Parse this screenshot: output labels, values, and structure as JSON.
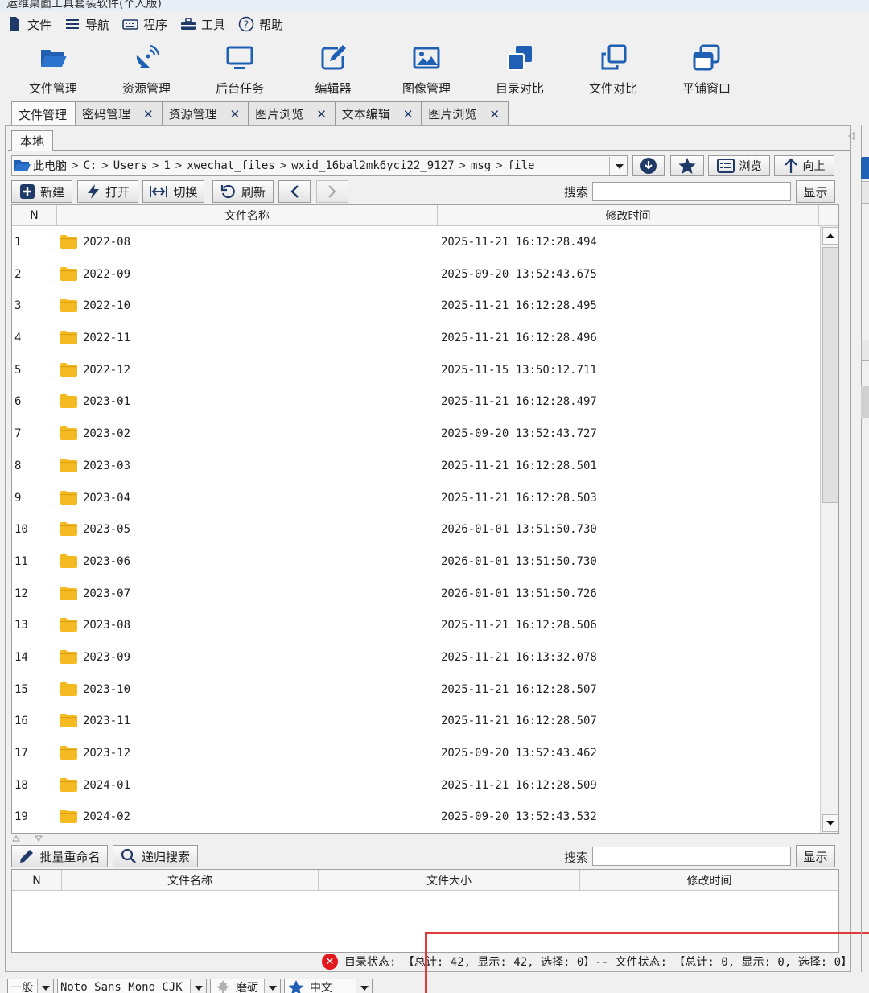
{
  "window": {
    "title": "运维桌面工具套装软件(个人版)"
  },
  "menu": [
    {
      "label": "文件",
      "icon": "file-icon"
    },
    {
      "label": "导航",
      "icon": "hamburger-icon"
    },
    {
      "label": "程序",
      "icon": "keyboard-icon"
    },
    {
      "label": "工具",
      "icon": "toolbox-icon"
    },
    {
      "label": "帮助",
      "icon": "help-icon"
    }
  ],
  "toolbar": [
    {
      "label": "文件管理",
      "icon": "folder-open-icon"
    },
    {
      "label": "资源管理",
      "icon": "satellite-dish-icon"
    },
    {
      "label": "后台任务",
      "icon": "monitor-icon"
    },
    {
      "label": "编辑器",
      "icon": "edit-icon"
    },
    {
      "label": "图像管理",
      "icon": "image-icon"
    },
    {
      "label": "目录对比",
      "icon": "stacked-squares-icon"
    },
    {
      "label": "文件对比",
      "icon": "copy-icon"
    },
    {
      "label": "平铺窗口",
      "icon": "windows-icon"
    }
  ],
  "tabs": [
    {
      "label": "文件管理",
      "closable": false,
      "active": true
    },
    {
      "label": "密码管理",
      "closable": true
    },
    {
      "label": "资源管理",
      "closable": true
    },
    {
      "label": "图片浏览",
      "closable": true
    },
    {
      "label": "文本编辑",
      "closable": true
    },
    {
      "label": "图片浏览",
      "closable": true
    }
  ],
  "tab_close_glyph": "✕",
  "subtab": {
    "label": "本地"
  },
  "path": {
    "segments": [
      "此电脑",
      "C:",
      "Users",
      "1",
      "xwechat_files",
      "wxid_16bal2mk6yci22_9127",
      "msg",
      "file"
    ],
    "separator": ">",
    "browse_label": "浏览",
    "up_label": "向上"
  },
  "actions": {
    "new": "新建",
    "open": "打开",
    "switch": "切换",
    "refresh": "刷新",
    "search_label": "搜索",
    "search_value": "",
    "show": "显示"
  },
  "table": {
    "columns": [
      "N",
      "文件名称",
      "修改时间"
    ],
    "rows": [
      {
        "n": "1",
        "name": "2022-08",
        "time": "2025-11-21 16:12:28.494"
      },
      {
        "n": "2",
        "name": "2022-09",
        "time": "2025-09-20 13:52:43.675"
      },
      {
        "n": "3",
        "name": "2022-10",
        "time": "2025-11-21 16:12:28.495"
      },
      {
        "n": "4",
        "name": "2022-11",
        "time": "2025-11-21 16:12:28.496"
      },
      {
        "n": "5",
        "name": "2022-12",
        "time": "2025-11-15 13:50:12.711"
      },
      {
        "n": "6",
        "name": "2023-01",
        "time": "2025-11-21 16:12:28.497"
      },
      {
        "n": "7",
        "name": "2023-02",
        "time": "2025-09-20 13:52:43.727"
      },
      {
        "n": "8",
        "name": "2023-03",
        "time": "2025-11-21 16:12:28.501"
      },
      {
        "n": "9",
        "name": "2023-04",
        "time": "2025-11-21 16:12:28.503"
      },
      {
        "n": "10",
        "name": "2023-05",
        "time": "2026-01-01 13:51:50.730"
      },
      {
        "n": "11",
        "name": "2023-06",
        "time": "2026-01-01 13:51:50.730"
      },
      {
        "n": "12",
        "name": "2023-07",
        "time": "2026-01-01 13:51:50.726"
      },
      {
        "n": "13",
        "name": "2023-08",
        "time": "2025-11-21 16:12:28.506"
      },
      {
        "n": "14",
        "name": "2023-09",
        "time": "2025-11-21 16:13:32.078"
      },
      {
        "n": "15",
        "name": "2023-10",
        "time": "2025-11-21 16:12:28.507"
      },
      {
        "n": "16",
        "name": "2023-11",
        "time": "2025-11-21 16:12:28.507"
      },
      {
        "n": "17",
        "name": "2023-12",
        "time": "2025-09-20 13:52:43.462"
      },
      {
        "n": "18",
        "name": "2024-01",
        "time": "2025-11-21 16:12:28.509"
      },
      {
        "n": "19",
        "name": "2024-02",
        "time": "2025-09-20 13:52:43.532"
      }
    ]
  },
  "lower": {
    "rename": "批量重命名",
    "recursive_search": "递归搜索",
    "search_label": "搜索",
    "search_value": "",
    "show": "显示",
    "columns": [
      "N",
      "文件名称",
      "文件大小",
      "修改时间"
    ]
  },
  "status": {
    "text": "目录状态: 【总计: 42, 显示: 42, 选择: 0】-- 文件状态: 【总计: 0, 显示: 0, 选择: 0】"
  },
  "bottom": {
    "mode": "一般",
    "font": "Noto Sans Mono CJK SC",
    "theme": "磨砺",
    "language": "中文"
  },
  "colors": {
    "folder": "#f5b921",
    "icon_blue": "#1f5fb4",
    "accent_red": "#e03a3a"
  }
}
